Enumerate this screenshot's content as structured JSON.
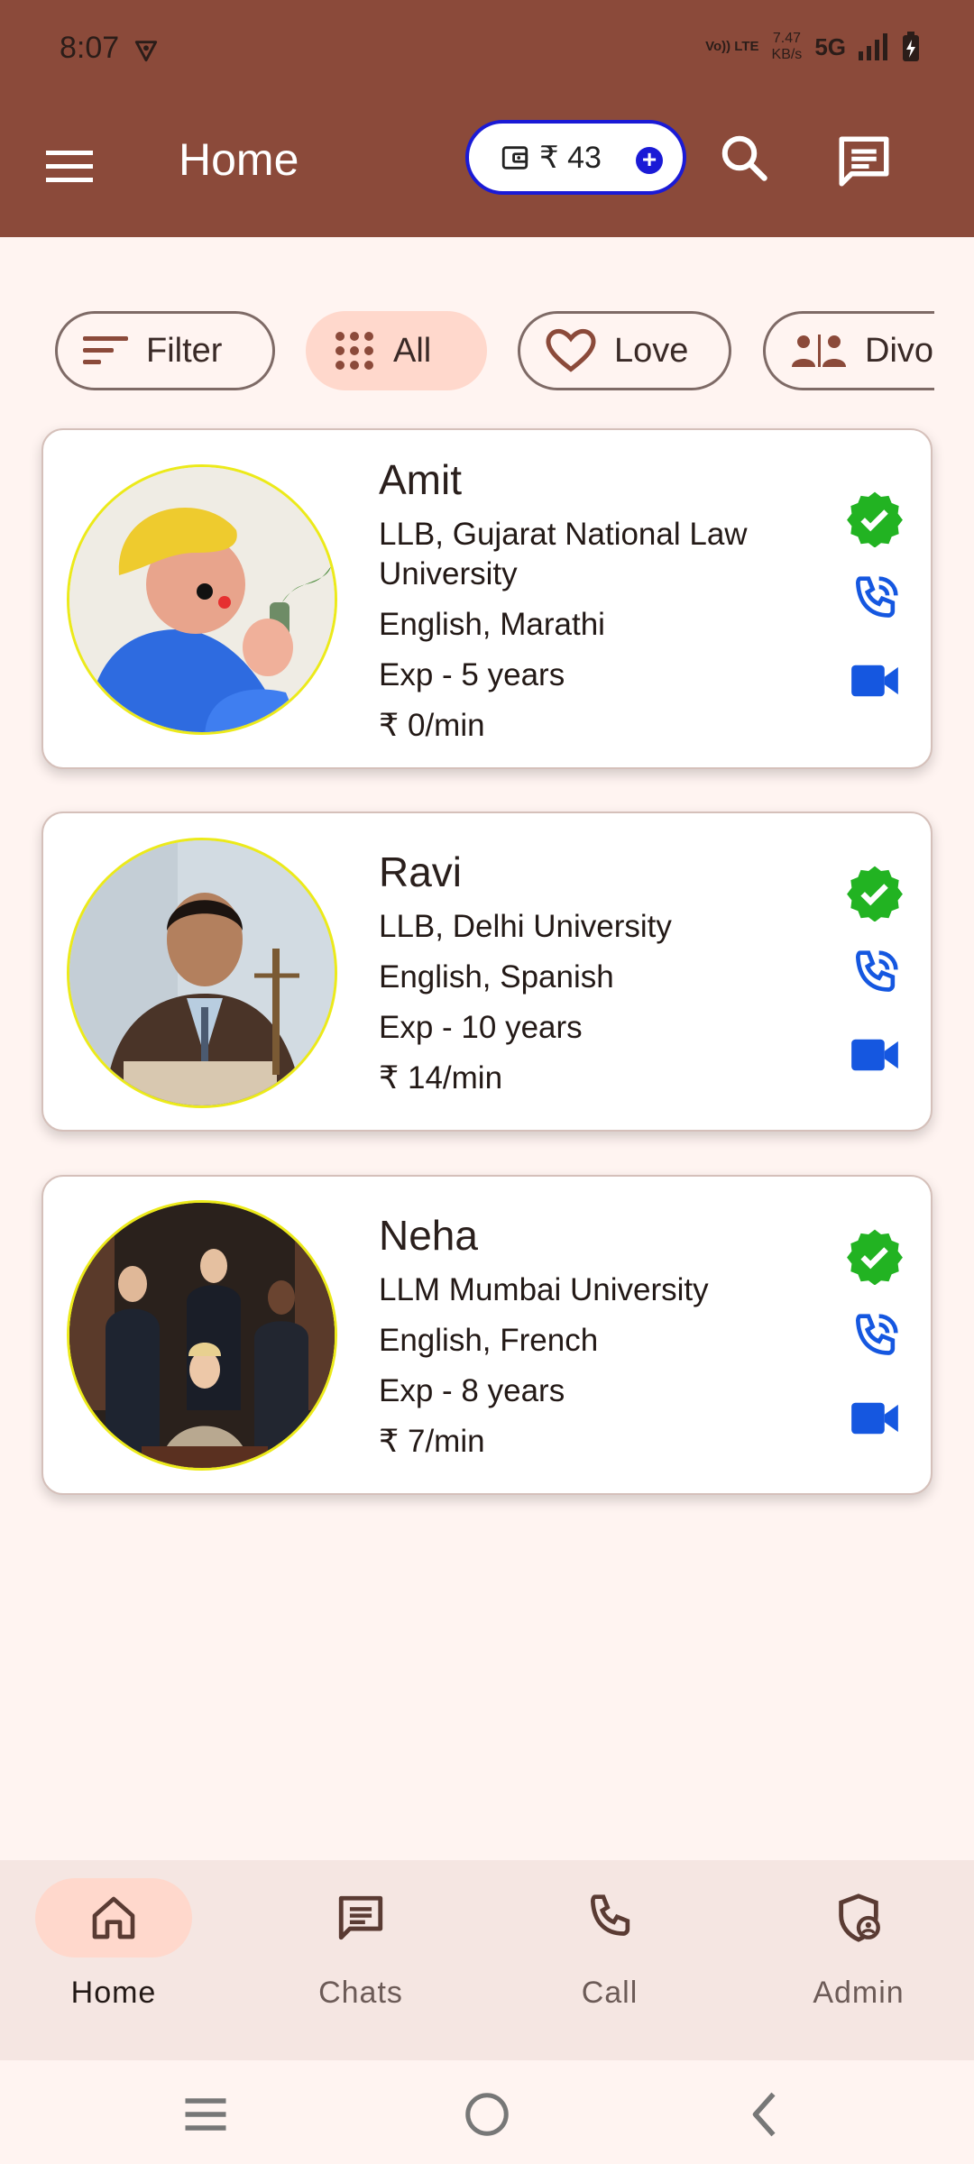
{
  "status_bar": {
    "time": "8:07",
    "volte": "Vo)) LTE",
    "speed_value": "7.47",
    "speed_unit": "KB/s",
    "network": "5G"
  },
  "app_bar": {
    "title": "Home",
    "wallet_amount": "₹ 43"
  },
  "filters": [
    {
      "label": "Filter",
      "icon": "filter-icon",
      "active": false
    },
    {
      "label": "All",
      "icon": "grid-icon",
      "active": true
    },
    {
      "label": "Love",
      "icon": "heart-icon",
      "active": false
    },
    {
      "label": "Divorce",
      "icon": "people-icon",
      "active": false
    }
  ],
  "lawyers": [
    {
      "name": "Amit",
      "education": "LLB, Gujarat National Law University",
      "languages": "English, Marathi",
      "experience": "Exp - 5 years",
      "rate": "₹ 0/min"
    },
    {
      "name": "Ravi",
      "education": "LLB, Delhi University",
      "languages": "English, Spanish",
      "experience": "Exp - 10 years",
      "rate": "₹ 14/min"
    },
    {
      "name": "Neha",
      "education": "LLM Mumbai University",
      "languages": "English, French",
      "experience": "Exp - 8 years",
      "rate": "₹ 7/min"
    }
  ],
  "bottom_nav": [
    {
      "label": "Home",
      "icon": "home-icon",
      "active": true
    },
    {
      "label": "Chats",
      "icon": "chat-icon",
      "active": false
    },
    {
      "label": "Call",
      "icon": "phone-icon",
      "active": false
    },
    {
      "label": "Admin",
      "icon": "admin-shield-icon",
      "active": false
    }
  ],
  "colors": {
    "header": "#8b4a3a",
    "background": "#fff4f1",
    "active_chip": "#ffd8cc",
    "verified": "#22b322",
    "action_blue": "#1557e0",
    "wallet_border": "#1a1ad6"
  }
}
